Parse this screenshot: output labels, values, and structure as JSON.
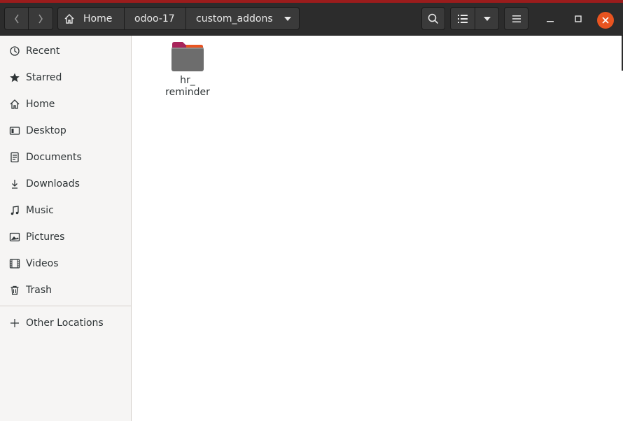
{
  "window": {
    "title": "custom_addons"
  },
  "navigation": {
    "back_icon": "chevron-left-icon",
    "forward_icon": "chevron-right-icon"
  },
  "breadcrumb": [
    {
      "label": "Home",
      "icon": "home-icon"
    },
    {
      "label": "odoo-17"
    },
    {
      "label": "custom_addons",
      "icon": "dropdown-arrow-icon"
    }
  ],
  "toolbar": {
    "search_icon": "search-icon",
    "view_icon": "list-view-icon",
    "view_options_icon": "dropdown-arrow-icon",
    "menu_icon": "hamburger-menu-icon"
  },
  "window_controls": {
    "minimize_icon": "minimize-icon",
    "maximize_icon": "maximize-icon",
    "close_icon": "close-icon"
  },
  "sidebar": {
    "items": [
      {
        "label": "Recent",
        "icon": "clock-icon"
      },
      {
        "label": "Starred",
        "icon": "star-icon"
      },
      {
        "label": "Home",
        "icon": "home-icon"
      },
      {
        "label": "Desktop",
        "icon": "desktop-icon"
      },
      {
        "label": "Documents",
        "icon": "document-icon"
      },
      {
        "label": "Downloads",
        "icon": "download-icon"
      },
      {
        "label": "Music",
        "icon": "music-icon"
      },
      {
        "label": "Pictures",
        "icon": "picture-icon"
      },
      {
        "label": "Videos",
        "icon": "video-icon"
      },
      {
        "label": "Trash",
        "icon": "trash-icon"
      }
    ],
    "other_locations": {
      "label": "Other Locations",
      "icon": "plus-icon"
    }
  },
  "files": [
    {
      "name": "hr_\nreminder",
      "type": "folder"
    }
  ],
  "colors": {
    "headerbar": "#2c2c2c",
    "accent_top": "#9b1c1c",
    "close_button": "#e95420",
    "folder_body": "#6d6d6d",
    "folder_tab": "#a8245a"
  }
}
